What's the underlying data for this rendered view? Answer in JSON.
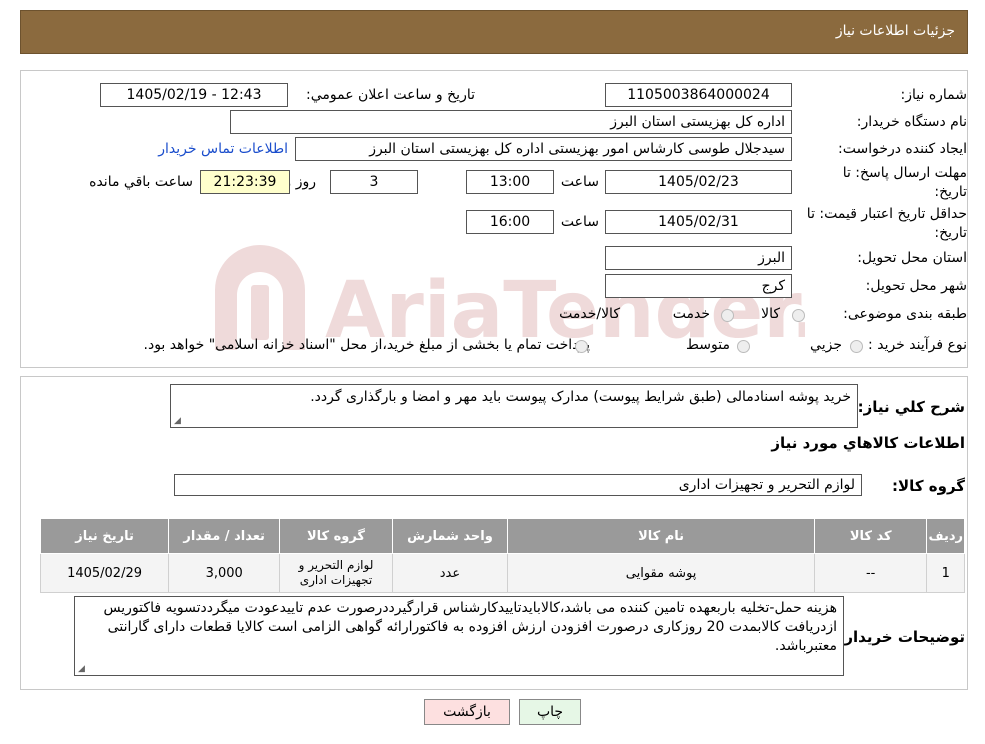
{
  "header": {
    "title": "جزئیات اطلاعات نیاز"
  },
  "form": {
    "need_number_label": "شماره نیاز:",
    "need_number": "1105003864000024",
    "announce_label": "تاریخ و ساعت اعلان عمومي:",
    "announce_value": "1405/02/19 - 12:43",
    "buyer_org_label": "نام دستگاه خریدار:",
    "buyer_org": "اداره کل بهزیستی استان البرز",
    "creator_label": "ایجاد کننده درخواست:",
    "creator": "سیدجلال طوسی کارشاس امور بهزیستی اداره کل بهزیستی استان البرز",
    "contact_link": "اطلاعات تماس خریدار",
    "deadline_label_1": "مهلت ارسال پاسخ: تا",
    "deadline_label_2": "تاریخ:",
    "deadline_date": "1405/02/23",
    "hour_label": "ساعت",
    "deadline_time": "13:00",
    "days_value": "3",
    "days_label": "روز و",
    "remaining_time": "21:23:39",
    "remaining_label": "ساعت باقي مانده",
    "validity_label_1": "حداقل تاریخ اعتبار قیمت: تا",
    "validity_label_2": "تاریخ:",
    "validity_date": "1405/02/31",
    "validity_hour_label": "ساعت",
    "validity_time": "16:00",
    "province_label": "استان محل تحویل:",
    "province": "البرز",
    "city_label": "شهر محل تحویل:",
    "city": "کرج",
    "category_label": "طبقه بندی موضوعی:",
    "category_options": [
      "کالا",
      "خدمت",
      "کالا/خدمت"
    ],
    "process_label": "نوع فرآیند خرید :",
    "process_options": [
      "جزیي",
      "متوسط"
    ],
    "process_note": "پرداخت تمام یا بخشی از مبلغ خرید،از محل \"اسناد خزانه اسلامی\" خواهد بود."
  },
  "summary": {
    "description_label": "شرح کلي نیاز:",
    "description": "خرید پوشه اسنادمالی (طبق شرایط پیوست) مدارک پیوست باید مهر و امضا و بارگذاری گردد.",
    "goods_info_title": "اطلاعات کالاهاي مورد نیاز",
    "goods_group_label": "گروه کالا:",
    "goods_group": "لوازم التحریر و تجهیزات اداری"
  },
  "table": {
    "headers": [
      "ردیف",
      "کد کالا",
      "نام کالا",
      "واحد شمارش",
      "گروه کالا",
      "تعداد / مقدار",
      "تاریخ نیاز"
    ],
    "rows": [
      [
        "1",
        "--",
        "پوشه مقوایی",
        "عدد",
        "لوازم التحریر و تجهیزات اداری",
        "3,000",
        "1405/02/29"
      ]
    ]
  },
  "buyer_notes": {
    "label": "توضیحات خریدار:",
    "text": "هزینه حمل-تخلیه باربعهده تامین کننده می باشد،کالابایدتاییدکارشناس قرارگیرددرصورت عدم تاییدعودت میگرددتسویه فاکتوریس ازدریافت کالابمدت 20 روزکاری درصورت افزودن ارزش افزوده به فاکتورارائه گواهی الزامی است کالایا قطعات دارای گارانتی معتبرباشد."
  },
  "buttons": {
    "print": "چاپ",
    "back": "بازگشت"
  },
  "watermark": {
    "text": "AriaTender.neT"
  },
  "colors": {
    "header_bg": "#8b6a3e",
    "table_header_bg": "#9a9a9a",
    "remaining_bg": "#ffffcc",
    "link": "#1a4dcc",
    "back_button_bg": "#fde0e0",
    "print_button_bg": "#e6f7e6"
  }
}
